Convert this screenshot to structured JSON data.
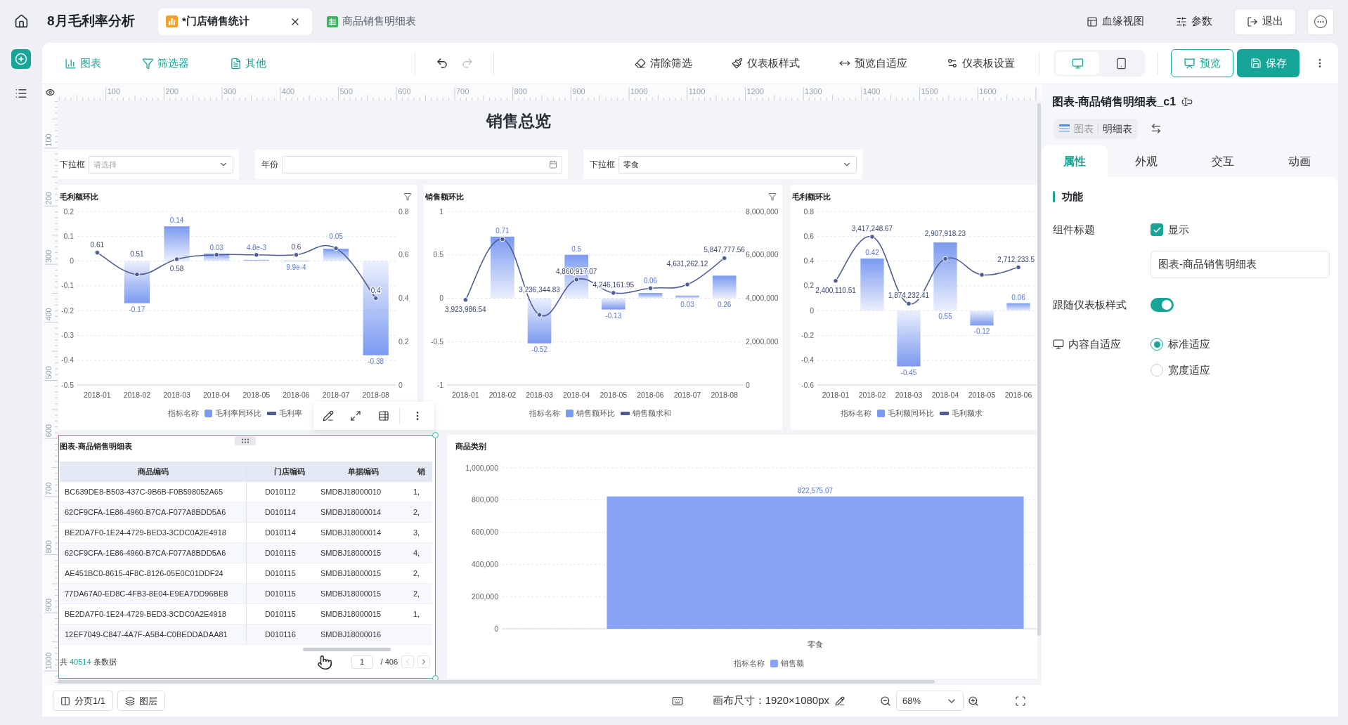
{
  "top_bar": {
    "title": "8月毛利率分析",
    "tabs": [
      {
        "label": "*门店销售统计",
        "kind": "chart",
        "selected": true,
        "closable": true
      },
      {
        "label": "商品销售明细表",
        "kind": "table",
        "selected": false,
        "closable": false
      }
    ],
    "actions": [
      {
        "label": "血缘视图",
        "kind": "lineage"
      },
      {
        "label": "参数",
        "kind": "params"
      },
      {
        "label": "退出",
        "kind": "exit"
      }
    ]
  },
  "toolbar": {
    "insert": [
      {
        "label": "图表",
        "kind": "chart"
      },
      {
        "label": "筛选器",
        "kind": "filter"
      },
      {
        "label": "其他",
        "kind": "other"
      }
    ],
    "undo": {
      "disabled": false
    },
    "redo": {
      "disabled": true
    },
    "tools": [
      {
        "label": "清除筛选",
        "kind": "clear"
      },
      {
        "label": "仪表板样式",
        "kind": "style"
      },
      {
        "label": "预览自适应",
        "kind": "fit"
      },
      {
        "label": "仪表板设置",
        "kind": "settings"
      }
    ],
    "devices": [
      {
        "kind": "desktop",
        "selected": true
      },
      {
        "kind": "mobile",
        "selected": false
      }
    ],
    "preview": "预览",
    "save": "保存"
  },
  "ruler": {
    "top_labels": [
      "100",
      "200",
      "300",
      "400",
      "500",
      "600",
      "700",
      "800",
      "900",
      "1000",
      "1100",
      "1200",
      "1300",
      "1400",
      "1500",
      "1600"
    ],
    "left_labels": [
      "100",
      "200",
      "300",
      "400",
      "500",
      "600",
      "700",
      "800",
      "900",
      "1000"
    ]
  },
  "canvas": {
    "title": "销售总览",
    "filters": [
      {
        "kind": "select",
        "label": "下拉框",
        "placeholder": "请选择"
      },
      {
        "kind": "date",
        "label": "年份"
      },
      {
        "kind": "select",
        "label": "下拉框",
        "value": "零食"
      }
    ],
    "charts": [
      {
        "show_filter": true,
        "legend_title": "指标名称",
        "chart_data": {
          "type": "bar",
          "title": "毛利额环比",
          "grid": true,
          "categories": [
            "2018-01",
            "2018-02",
            "2018-03",
            "2018-04",
            "2018-05",
            "2018-06",
            "2018-07",
            "2018-08"
          ],
          "ylim": [
            -0.5,
            0.2
          ],
          "yticks": [
            0.2,
            0.1,
            0,
            -0.1,
            -0.2,
            -0.3,
            -0.4,
            -0.5
          ],
          "y2lim": [
            0,
            0.8
          ],
          "y2ticks": [
            0.8,
            0.6,
            0.4,
            0.2,
            0
          ],
          "series": [
            {
              "name": "毛利率同环比",
              "type": "bar",
              "color": "#7b9af0",
              "values": [
                null,
                -0.17,
                0.14,
                0.03,
                0.0048,
                0.00099,
                0.05,
                -0.38
              ],
              "value_labels": [
                null,
                "-0.17",
                "0.14",
                "0.03",
                "4.8e-3",
                "9.9e-4",
                "0.05",
                "-0.38"
              ]
            },
            {
              "name": "毛利率",
              "type": "line",
              "axis": "y2",
              "marker": true,
              "color": "#4f5d95",
              "values": [
                0.61,
                0.51,
                0.58,
                0.6,
                0.6,
                0.6,
                0.63,
                0.4
              ],
              "value_labels": [
                "0.61",
                "0.51",
                "0.58",
                null,
                null,
                "0.6",
                null,
                "0.4"
              ]
            }
          ]
        }
      },
      {
        "show_filter": true,
        "legend_title": "指标名称",
        "chart_data": {
          "type": "bar",
          "title": "销售额环比",
          "grid": true,
          "categories": [
            "2018-01",
            "2018-02",
            "2018-03",
            "2018-04",
            "2018-05",
            "2018-06",
            "2018-07",
            "2018-08"
          ],
          "ylim": [
            -1,
            1
          ],
          "yticks": [
            1,
            0.5,
            0,
            -0.5,
            -1
          ],
          "y2lim": [
            0,
            8000000
          ],
          "y2ticks": [
            {
              "value": 8000000,
              "label": "8,000,000"
            },
            {
              "value": 6000000,
              "label": "6,000,000"
            },
            {
              "value": 4000000,
              "label": "4,000,000"
            },
            {
              "value": 2000000,
              "label": "2,000,000"
            },
            {
              "value": 0,
              "label": "0"
            }
          ],
          "series": [
            {
              "name": "销售额环比",
              "type": "bar",
              "color": "#7b9af0",
              "values": [
                null,
                0.71,
                -0.52,
                0.5,
                -0.13,
                0.06,
                0.03,
                0.26
              ],
              "value_labels": [
                null,
                "0.71",
                "-0.52",
                "0.5",
                "-0.13",
                "0.06",
                "0.03",
                "0.26"
              ]
            },
            {
              "name": "销售额求和",
              "type": "line",
              "axis": "y2",
              "marker": true,
              "color": "#4f5d95",
              "values": [
                3923986.54,
                6720000,
                3236344.83,
                4860917.07,
                4246161.95,
                4460000,
                4631262.12,
                5847777.56
              ],
              "value_labels": [
                "3,923,986.54",
                null,
                "3,236,344.83",
                "4,860,917.07",
                "4,246,161.95",
                null,
                "4,631,262.12",
                "5,847,777.56"
              ]
            }
          ]
        }
      },
      {
        "show_filter": false,
        "legend_title": "指标名称",
        "chart_data": {
          "type": "bar",
          "title": "毛利额环比",
          "grid": true,
          "categories": [
            "2018-01",
            "2018-02",
            "2018-03",
            "2018-04",
            "2018-05",
            "2018-06"
          ],
          "ylim": [
            -0.6,
            0.8
          ],
          "yticks": [
            0.8,
            0.6,
            0.4,
            0.2,
            0,
            -0.2,
            -0.4,
            -0.6
          ],
          "y2lim": [
            0,
            4000000
          ],
          "series": [
            {
              "name": "毛利额同环比",
              "type": "bar",
              "color": "#7b9af0",
              "values": [
                null,
                0.42,
                -0.45,
                0.55,
                -0.12,
                0.06
              ],
              "value_labels": [
                null,
                "0.42",
                "-0.45",
                "0.55",
                "-0.12",
                "0.06"
              ]
            },
            {
              "name": "毛利额求",
              "type": "line",
              "axis": "y2",
              "marker": true,
              "color": "#4f5d95",
              "values": [
                2400110.51,
                3417248.67,
                1874232.41,
                2907918.23,
                2540000,
                2712233.5
              ],
              "value_labels": [
                "2,400,110.51",
                "3,417,248.67",
                "1,874,232.41",
                "2,907,918.23",
                null,
                "2,712,233.5"
              ]
            }
          ]
        }
      }
    ],
    "table": {
      "title": "图表-商品销售明细表",
      "selected": true,
      "columns": [
        "商品编码",
        "门店编码",
        "单据编码",
        "销"
      ],
      "rows": [
        [
          "BC639DE8-B503-437C-9B6B-F0B598052A65",
          "D010112",
          "SMDBJ18000010",
          "1,"
        ],
        [
          "62CF9CFA-1E86-4960-B7CA-F077A8BDD5A6",
          "D010114",
          "SMDBJ18000014",
          "2,"
        ],
        [
          "BE2DA7F0-1E24-4729-BED3-3CDC0A2E4918",
          "D010114",
          "SMDBJ18000014",
          "3,"
        ],
        [
          "62CF9CFA-1E86-4960-B7CA-F077A8BDD5A6",
          "D010115",
          "SMDBJ18000015",
          "4,"
        ],
        [
          "AE451BC0-8615-4F8C-8126-05E0C01DDF24",
          "D010115",
          "SMDBJ18000015",
          "2,"
        ],
        [
          "77DA67A0-ED8C-4FB3-8E04-E9EA7DD96BE8",
          "D010115",
          "SMDBJ18000015",
          "2,"
        ],
        [
          "BE2DA7F0-1E24-4729-BED3-3CDC0A2E4918",
          "D010115",
          "SMDBJ18000015",
          "1,"
        ],
        [
          "12EF7049-C847-4A7F-A5B4-C0BEDDADAA81",
          "D010116",
          "SMDBJ18000016"
        ]
      ],
      "footer": {
        "prefix": "共",
        "count": "40514",
        "suffix": "条数据"
      },
      "pager": {
        "page": "1",
        "total": "/ 406",
        "prev_disabled": true,
        "next_disabled": false
      }
    },
    "category_chart": {
      "legend_title": "指标名称",
      "chart_data": {
        "type": "bar",
        "title": "商品类别",
        "grid": true,
        "categories": [
          "零食"
        ],
        "ylim": [
          0,
          1000000
        ],
        "yticks": [
          {
            "value": 0,
            "label": "0"
          },
          {
            "value": 200000,
            "label": "200,000"
          },
          {
            "value": 400000,
            "label": "400,000"
          },
          {
            "value": 600000,
            "label": "600,000"
          },
          {
            "value": 800000,
            "label": "800,000"
          },
          {
            "value": 1000000,
            "label": "1,000,000"
          }
        ],
        "series": [
          {
            "name": "销售额",
            "type": "bar",
            "color": "#86a4f3",
            "values": [
              822575.07
            ],
            "value_labels": [
              "822,575.07"
            ]
          }
        ]
      }
    }
  },
  "bottom_bar": {
    "pages": "分页1/1",
    "layers": "图层",
    "canvas_size": "画布尺寸：1920×1080px",
    "zoom": "68%"
  },
  "properties_panel": {
    "title": "图表-商品销售明细表_c1",
    "component_type": {
      "category": "图表",
      "type": "明细表"
    },
    "tabs": [
      {
        "label": "属性",
        "selected": true
      },
      {
        "label": "外观",
        "selected": false
      },
      {
        "label": "交互",
        "selected": false
      },
      {
        "label": "动画",
        "selected": false
      }
    ],
    "section": "功能",
    "fields": [
      {
        "kind": "checkbox",
        "label": "组件标题",
        "option": "显示",
        "checked": true
      },
      {
        "kind": "text",
        "value": "图表-商品销售明细表"
      },
      {
        "kind": "switch",
        "label": "跟随仪表板样式",
        "on": true
      },
      {
        "kind": "radio",
        "label": "内容自适应",
        "options": [
          {
            "label": "标准适应",
            "selected": true
          },
          {
            "label": "宽度适应",
            "selected": false
          }
        ]
      }
    ]
  }
}
